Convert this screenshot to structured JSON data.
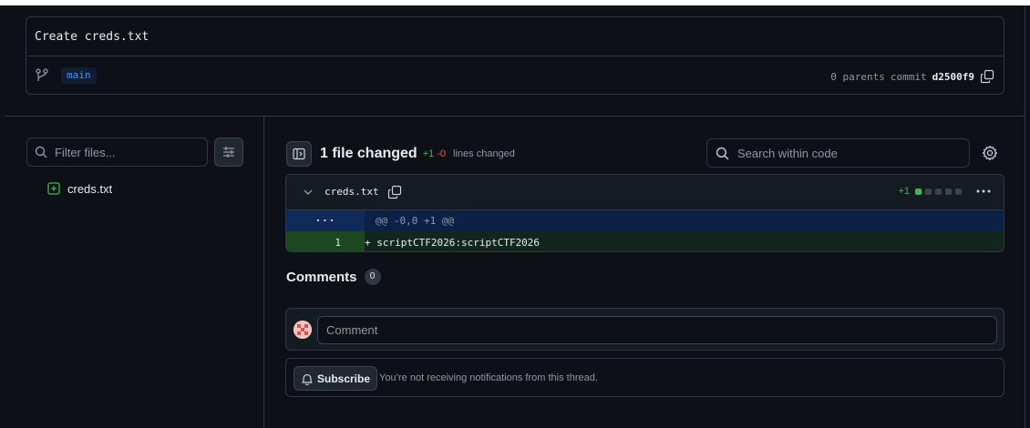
{
  "commit": {
    "title": "Create creds.txt",
    "branch": "main",
    "parents_label": "0 parents",
    "commit_label": "commit",
    "sha": "d2500f9"
  },
  "sidebar": {
    "filter_placeholder": "Filter files...",
    "files": [
      {
        "name": "creds.txt",
        "status": "added"
      }
    ]
  },
  "diff_summary": {
    "files_changed": "1 file changed",
    "additions": "+1",
    "deletions": "-0",
    "lines_changed_label": "lines changed"
  },
  "code_search": {
    "placeholder": "Search within code"
  },
  "diff_file": {
    "filename": "creds.txt",
    "additions": "+1",
    "stat_blocks": [
      "green",
      "neutral",
      "neutral",
      "neutral",
      "neutral"
    ],
    "hunk_gutter": "···",
    "hunk_header": "@@ -0,0 +1 @@",
    "lines": [
      {
        "number": "1",
        "content": "+ scriptCTF2026:scriptCTF2026"
      }
    ]
  },
  "comments": {
    "label": "Comments",
    "count": "0",
    "input_placeholder": "Comment",
    "subscribe_label": "Subscribe",
    "notification_text": "You’re not receiving notifications from this thread."
  },
  "colors": {
    "background": "#0d1117",
    "border": "#30363d",
    "addition": "#3fb950",
    "deletion": "#f85149",
    "link": "#4493f8"
  }
}
